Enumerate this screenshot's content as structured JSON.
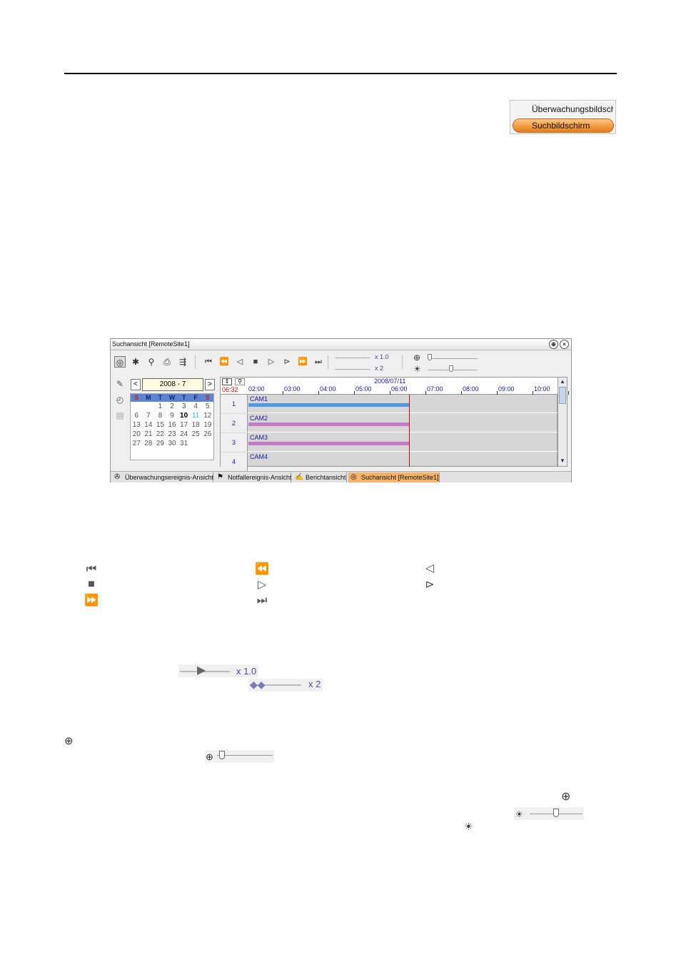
{
  "mode_switch": {
    "monitoring_label": "Überwachungsbildsch",
    "search_label": "Suchbildschirm"
  },
  "window": {
    "title": "Suchansicht [RemoteSite1]",
    "pin_glyph": "⊕",
    "close_glyph": "×",
    "speed": {
      "play_value": "x 1.0",
      "audio_value": "x 2"
    },
    "calendar": {
      "month": "2008 - 7",
      "prev": "<",
      "next": ">",
      "weekdays": [
        "S",
        "M",
        "T",
        "W",
        "T",
        "F",
        "S"
      ],
      "weekday_colors": [
        "#c81e1e",
        "#0a2a7a",
        "#0a2a7a",
        "#0a2a7a",
        "#0a2a7a",
        "#0a2a7a",
        "#c81e1e"
      ],
      "weeks": [
        [
          "",
          "",
          "1",
          "2",
          "3",
          "4",
          "5"
        ],
        [
          "6",
          "7",
          "8",
          "9",
          "10",
          "11",
          "12"
        ],
        [
          "13",
          "14",
          "15",
          "16",
          "17",
          "18",
          "19"
        ],
        [
          "20",
          "21",
          "22",
          "23",
          "24",
          "25",
          "26"
        ],
        [
          "27",
          "28",
          "29",
          "30",
          "31",
          "",
          ""
        ]
      ],
      "bold_day": "10",
      "today": "11",
      "today_color": "#1fc8d8"
    },
    "timeline": {
      "current_time": "06:32",
      "date": "2008/07/11",
      "ticks": [
        "02:00",
        "03:00",
        "04:00",
        "05:00",
        "06:00",
        "07:00",
        "08:00",
        "09:00",
        "10:00"
      ],
      "rows": [
        {
          "num": "1",
          "cam": "CAM1",
          "bar_color": "#4d9be0"
        },
        {
          "num": "2",
          "cam": "CAM2",
          "bar_color": "#c27cc8"
        },
        {
          "num": "3",
          "cam": "CAM3",
          "bar_color": "#c27cc8"
        },
        {
          "num": "4",
          "cam": "CAM4",
          "bar_color": ""
        }
      ]
    },
    "tabs": [
      {
        "label": "Überwachungsereignis-Ansicht",
        "icon": "monitoring-event-icon"
      },
      {
        "label": "Notfallereignis-Ansicht",
        "icon": "emergency-event-icon"
      },
      {
        "label": "Berichtansicht",
        "icon": "report-icon"
      },
      {
        "label": "Suchansicht [RemoteSite1]",
        "icon": "search-view-icon"
      }
    ]
  },
  "speed_examples": {
    "play_value": "x 1.0",
    "audio_value": "x 2"
  },
  "icons": {
    "first": "first-frame-icon",
    "fast_rewind": "fast-rewind-icon",
    "reverse_play": "reverse-play-icon",
    "stop": "stop-icon",
    "play": "play-icon",
    "next_frame": "next-frame-icon",
    "fast_forward": "fast-forward-icon",
    "last": "last-frame-icon",
    "zoom": "zoom-icon",
    "brightness": "brightness-icon"
  }
}
